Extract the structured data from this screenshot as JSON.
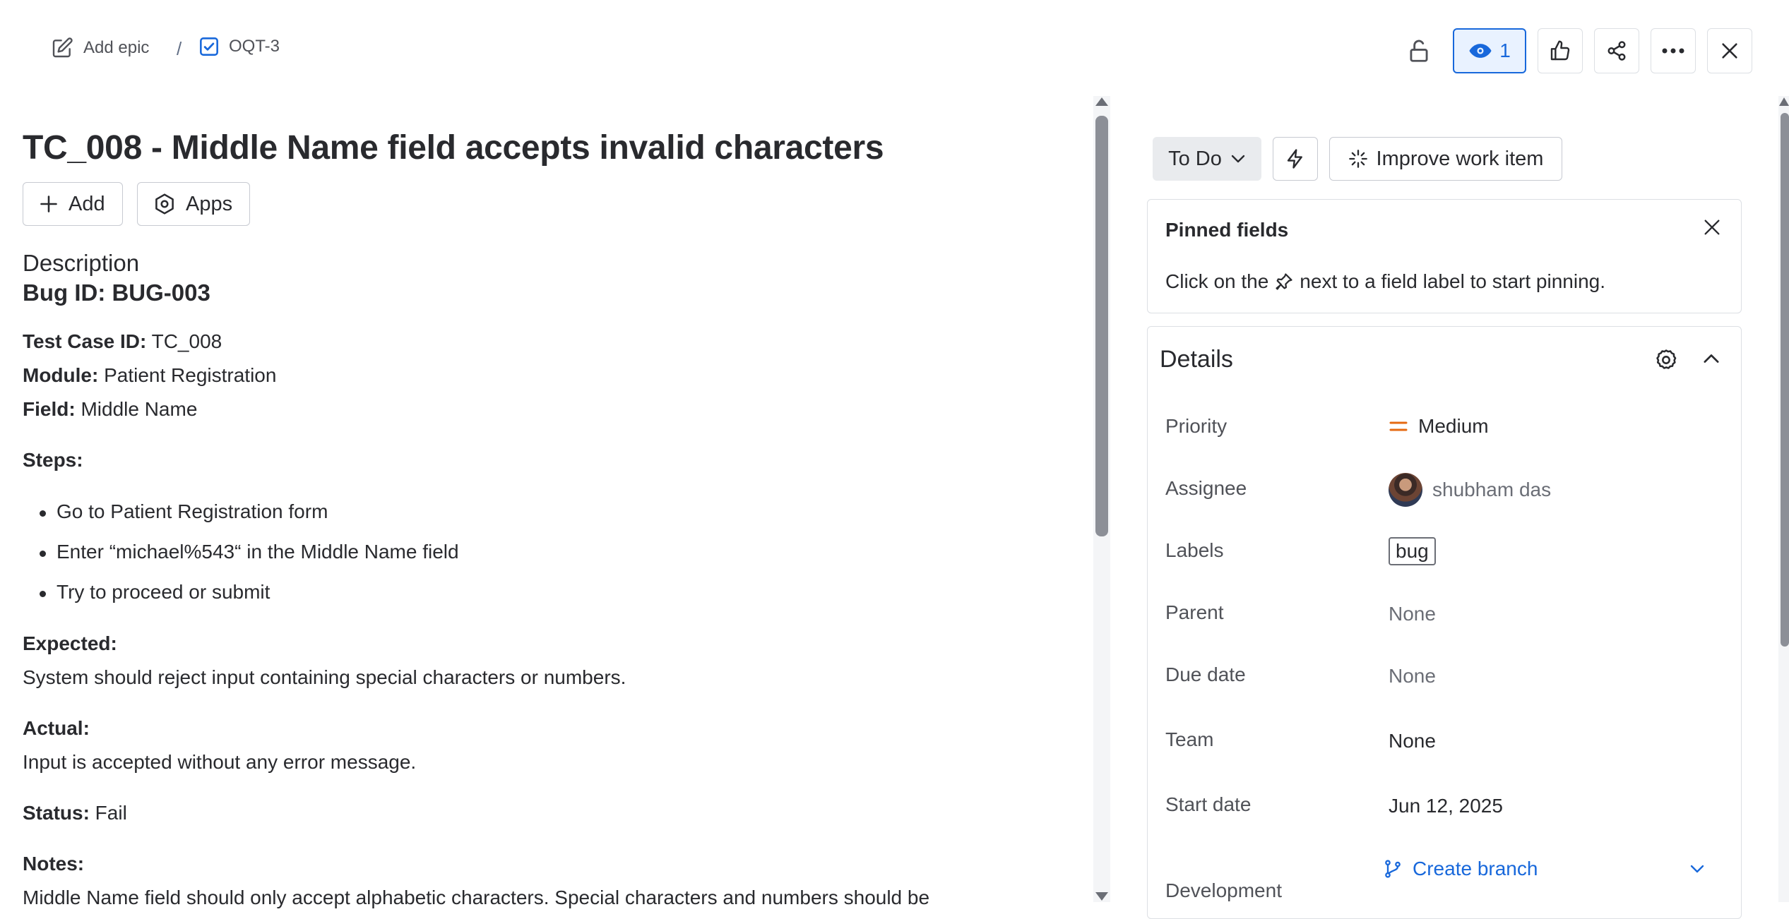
{
  "breadcrumb": {
    "add_epic_label": "Add epic",
    "separator": "/",
    "issue_key": "OQT-3"
  },
  "toolbar": {
    "watch_count": "1"
  },
  "issue": {
    "title": "TC_008 - Middle Name field accepts invalid characters",
    "add_label": "Add",
    "apps_label": "Apps"
  },
  "description": {
    "heading": "Description",
    "bug_id": "Bug ID: BUG-003",
    "fields": [
      {
        "label": "Test Case ID:",
        "value": " TC_008"
      },
      {
        "label": "Module:",
        "value": " Patient Registration"
      },
      {
        "label": "Field:",
        "value": " Middle Name"
      }
    ],
    "steps_label": "Steps:",
    "steps": [
      "Go to Patient Registration form",
      "Enter “michael%543“ in the Middle Name field",
      "Try to proceed or submit"
    ],
    "expected_label": "Expected:",
    "expected_text": "System should reject input containing special characters or numbers.",
    "actual_label": "Actual:",
    "actual_text": "Input is accepted without any error message.",
    "status_label": "Status:",
    "status_value": " Fail",
    "notes_label": "Notes:",
    "notes_text": "Middle Name field should only accept alphabetic characters. Special characters and numbers should be"
  },
  "sidebar": {
    "status": "To Do",
    "improve_label": "Improve work item",
    "pinned": {
      "title": "Pinned fields",
      "text_before": "Click on the",
      "text_after": "next to a field label to start pinning."
    },
    "details": {
      "title": "Details",
      "fields": {
        "priority": {
          "label": "Priority",
          "value": "Medium"
        },
        "assignee": {
          "label": "Assignee",
          "value": "shubham das"
        },
        "labels": {
          "label": "Labels",
          "value": "bug"
        },
        "parent": {
          "label": "Parent",
          "value": "None"
        },
        "due_date": {
          "label": "Due date",
          "value": "None"
        },
        "team": {
          "label": "Team",
          "value": "None"
        },
        "start_date": {
          "label": "Start date",
          "value": "Jun 12, 2025"
        },
        "development": {
          "label": "Development",
          "value": "Create branch"
        }
      }
    }
  },
  "colors": {
    "accent": "#1868db",
    "priority_medium": "#e56910",
    "text": "#292a2e"
  }
}
